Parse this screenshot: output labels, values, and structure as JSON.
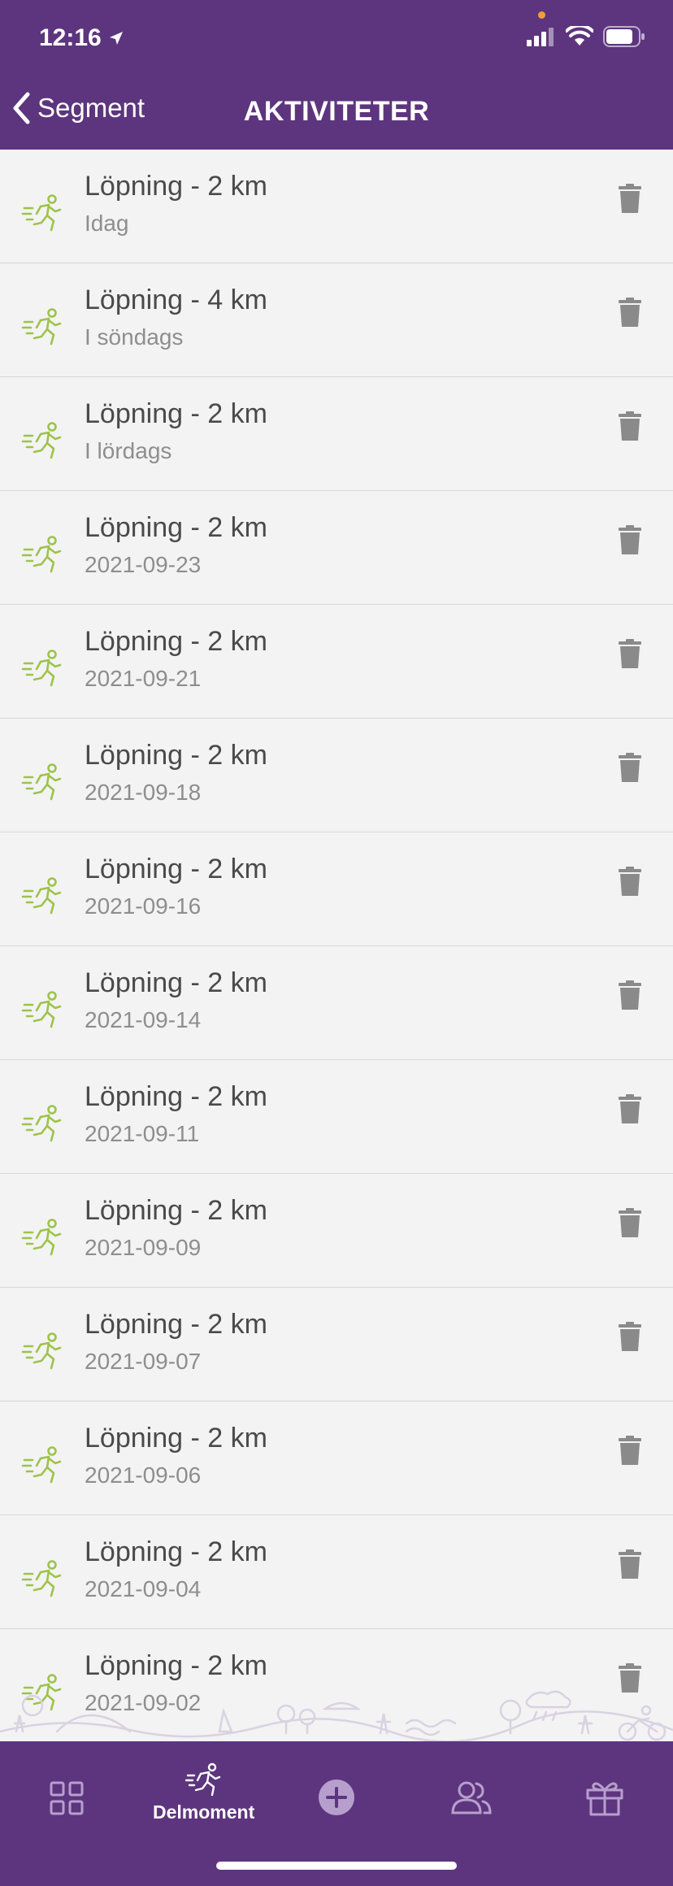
{
  "status_bar": {
    "time": "12:16"
  },
  "nav": {
    "back_label": "Segment",
    "title": "AKTIVITETER"
  },
  "activities": [
    {
      "title": "Löpning - 2 km",
      "date": "Idag"
    },
    {
      "title": "Löpning - 4 km",
      "date": "I söndags"
    },
    {
      "title": "Löpning - 2 km",
      "date": "I lördags"
    },
    {
      "title": "Löpning - 2 km",
      "date": "2021-09-23"
    },
    {
      "title": "Löpning - 2 km",
      "date": "2021-09-21"
    },
    {
      "title": "Löpning - 2 km",
      "date": "2021-09-18"
    },
    {
      "title": "Löpning - 2 km",
      "date": "2021-09-16"
    },
    {
      "title": "Löpning - 2 km",
      "date": "2021-09-14"
    },
    {
      "title": "Löpning - 2 km",
      "date": "2021-09-11"
    },
    {
      "title": "Löpning - 2 km",
      "date": "2021-09-09"
    },
    {
      "title": "Löpning - 2 km",
      "date": "2021-09-07"
    },
    {
      "title": "Löpning - 2 km",
      "date": "2021-09-06"
    },
    {
      "title": "Löpning - 2 km",
      "date": "2021-09-04"
    },
    {
      "title": "Löpning - 2 km",
      "date": "2021-09-02"
    }
  ],
  "tabbar": {
    "active_label": "Delmoment"
  },
  "colors": {
    "brand": "#5d357e",
    "run_icon": "#9dc34a",
    "trash": "#8a8a8a"
  }
}
